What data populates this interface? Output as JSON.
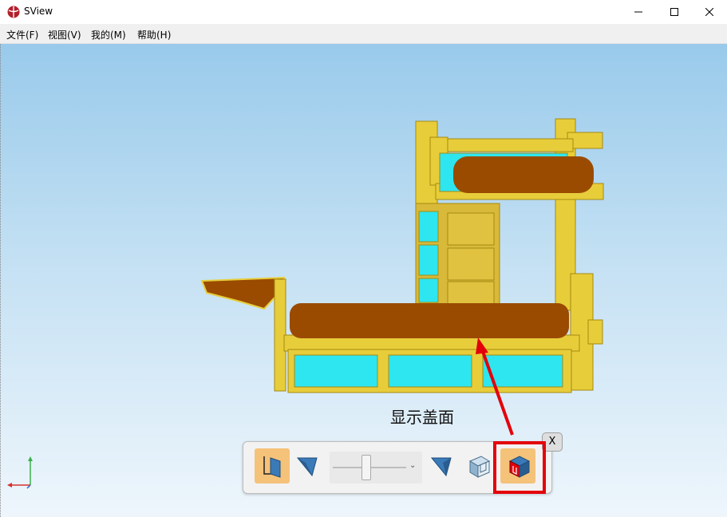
{
  "window": {
    "title": "SView",
    "controls": {
      "minimize": "—",
      "maximize": "☐",
      "close": "✕"
    }
  },
  "menu": [
    "文件(F)",
    "视图(V)",
    "我的(M)",
    "帮助(H)"
  ],
  "annotation": {
    "label": "显示盖面"
  },
  "toolbar": {
    "close_label": "X",
    "dropdown_chevron": "⌄",
    "buttons": [
      "axis-view-icon",
      "section-plane-icon",
      "section-slider",
      "flip-section-icon",
      "clip-part-icon",
      "show-cap-icon"
    ],
    "highlighted": "show-cap-icon"
  },
  "colors": {
    "accent_highlight": "#e3000b",
    "active_button": "#f5c27a",
    "model_wood": "#e8cd3a",
    "model_mattress": "#9a4b00",
    "model_glass": "#2de6f0"
  }
}
